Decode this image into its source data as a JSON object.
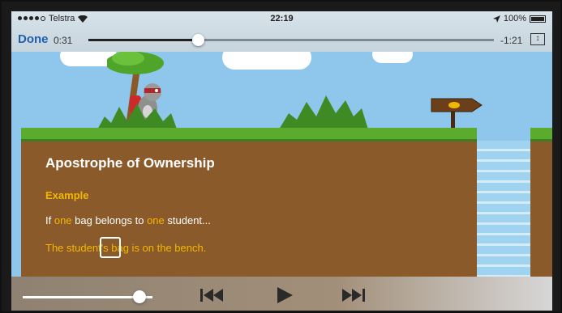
{
  "status_bar": {
    "carrier": "Telstra",
    "time": "22:19",
    "battery": "100%"
  },
  "player": {
    "done_label": "Done",
    "elapsed": "0:31",
    "remaining": "-1:21",
    "progress_fraction": 0.27,
    "volume_fraction": 0.9
  },
  "lesson": {
    "title": "Apostrophe of Ownership",
    "example_heading": "Example",
    "sentence1": {
      "p1": "If ",
      "p2": "one",
      "p3": " bag belongs to ",
      "p4": "one",
      "p5": " student..."
    },
    "sentence2": "The student's bag is on the bench."
  },
  "icons": {
    "previous": "skip-back-icon",
    "play": "play-icon",
    "next": "skip-forward-icon",
    "fit": "aspect-fit-icon",
    "wifi": "wifi-icon",
    "location": "location-arrow-icon"
  },
  "colors": {
    "accent": "#f2b705",
    "done": "#1f5fb0",
    "ground": "#8b5a2b",
    "grass": "#5bab2f",
    "sky": "#8fc7ec"
  }
}
